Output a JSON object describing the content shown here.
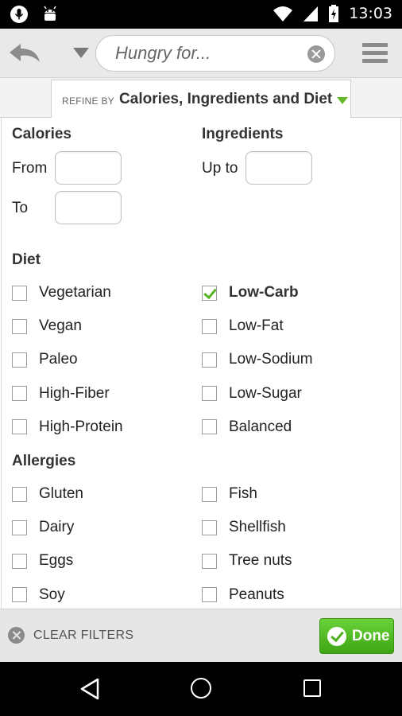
{
  "status_bar": {
    "time": "13:03",
    "icons": [
      "microphone-icon",
      "android-icon",
      "wifi-icon",
      "signal-icon",
      "battery-charging-icon"
    ]
  },
  "header": {
    "search_placeholder": "Hungry for...",
    "icons": [
      "undo-icon",
      "dropdown-caret-icon",
      "clear-search-icon",
      "menu-icon"
    ]
  },
  "refine": {
    "prefix": "REFINE BY",
    "title": "Calories, Ingredients and Diet"
  },
  "calories": {
    "heading": "Calories",
    "from_label": "From",
    "from_value": "",
    "to_label": "To",
    "to_value": ""
  },
  "ingredients": {
    "heading": "Ingredients",
    "upto_label": "Up to",
    "upto_value": ""
  },
  "diet": {
    "heading": "Diet",
    "items": [
      {
        "label": "Vegetarian",
        "checked": false
      },
      {
        "label": "Low-Carb",
        "checked": true
      },
      {
        "label": "Vegan",
        "checked": false
      },
      {
        "label": "Low-Fat",
        "checked": false
      },
      {
        "label": "Paleo",
        "checked": false
      },
      {
        "label": "Low-Sodium",
        "checked": false
      },
      {
        "label": "High-Fiber",
        "checked": false
      },
      {
        "label": "Low-Sugar",
        "checked": false
      },
      {
        "label": "High-Protein",
        "checked": false
      },
      {
        "label": "Balanced",
        "checked": false
      }
    ]
  },
  "allergies": {
    "heading": "Allergies",
    "items": [
      {
        "label": "Gluten",
        "checked": false
      },
      {
        "label": "Fish",
        "checked": false
      },
      {
        "label": "Dairy",
        "checked": false
      },
      {
        "label": "Shellfish",
        "checked": false
      },
      {
        "label": "Eggs",
        "checked": false
      },
      {
        "label": "Tree nuts",
        "checked": false
      },
      {
        "label": "Soy",
        "checked": false
      },
      {
        "label": "Peanuts",
        "checked": false
      }
    ]
  },
  "footer": {
    "clear_label": "CLEAR FILTERS",
    "done_label": "Done"
  },
  "colors": {
    "accent_green": "#55b223",
    "done_button": "#4caf1d",
    "header_bg": "#e9e9e9"
  }
}
